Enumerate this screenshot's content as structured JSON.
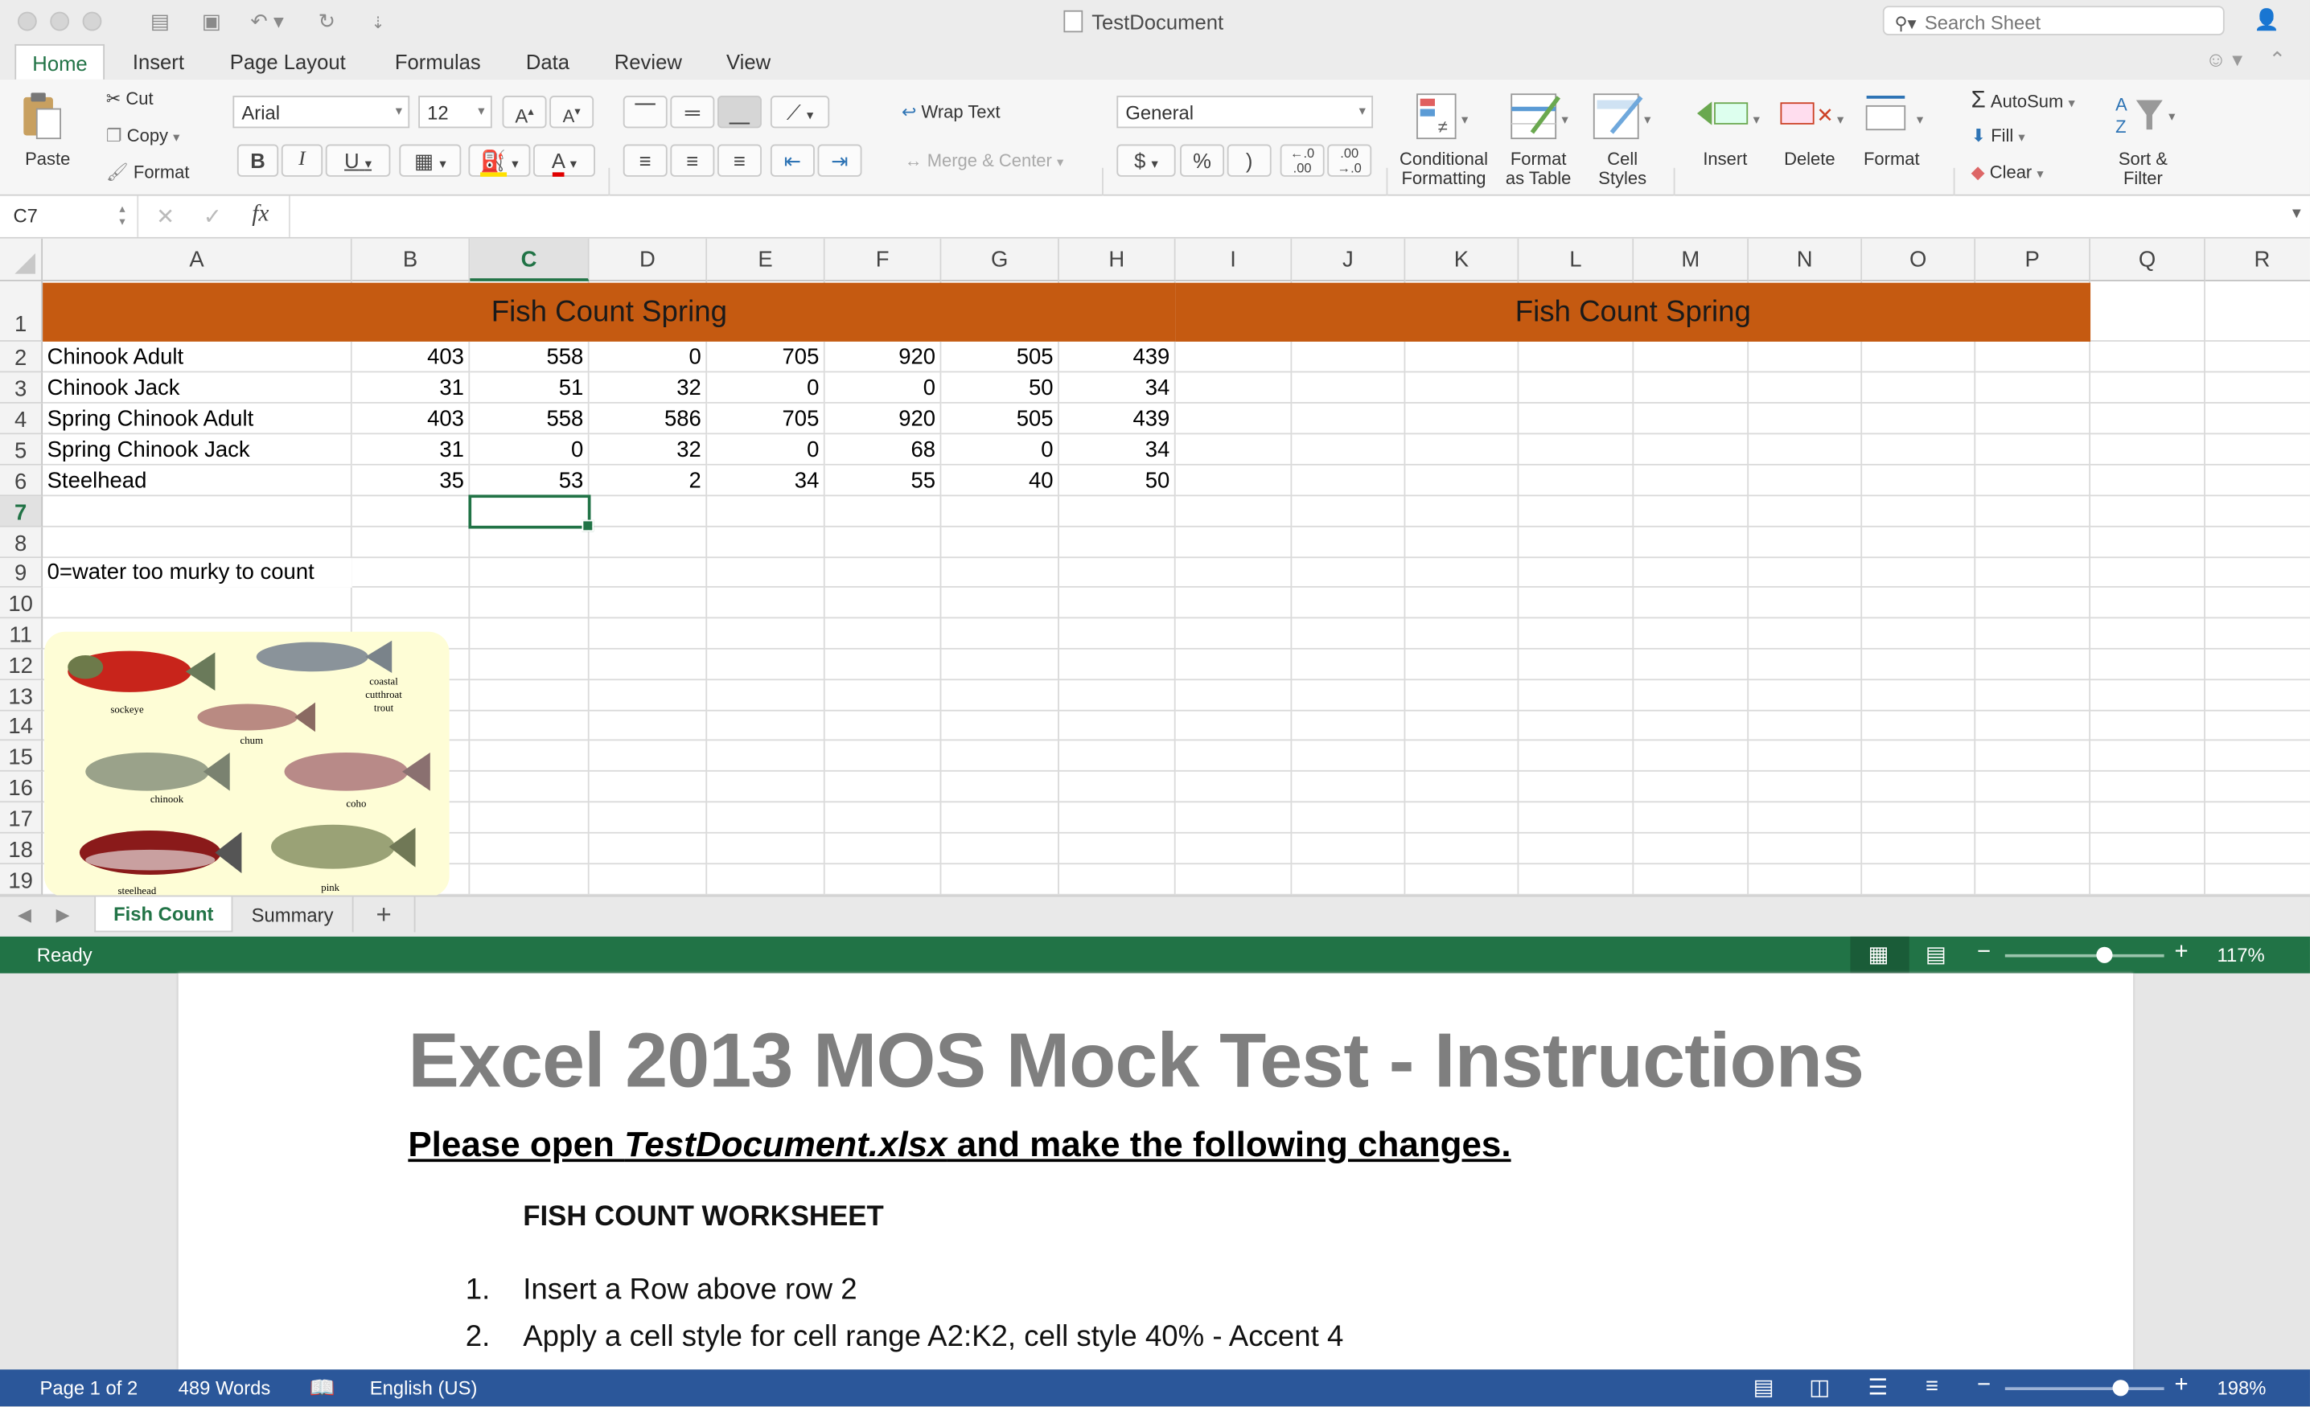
{
  "window": {
    "title": "TestDocument",
    "search_placeholder": "Search Sheet"
  },
  "ribbon_tabs": [
    "Home",
    "Insert",
    "Page Layout",
    "Formulas",
    "Data",
    "Review",
    "View"
  ],
  "ribbon": {
    "paste": "Paste",
    "cut": "Cut",
    "copy": "Copy",
    "format_painter": "Format",
    "font_name": "Arial",
    "font_size": "12",
    "bold": "B",
    "italic": "I",
    "underline": "U",
    "wrap_text": "Wrap Text",
    "merge_center": "Merge & Center",
    "number_format": "General",
    "currency": "$",
    "percent": "%",
    "comma": ")",
    "cond_format": [
      "Conditional",
      "Formatting"
    ],
    "format_table": [
      "Format",
      "as Table"
    ],
    "cell_styles": [
      "Cell",
      "Styles"
    ],
    "insert": "Insert",
    "delete": "Delete",
    "format": "Format",
    "autosum": "AutoSum",
    "fill": "Fill",
    "clear": "Clear",
    "sort_filter": [
      "Sort &",
      "Filter"
    ]
  },
  "formula_bar": {
    "name_box": "C7",
    "fx": "fx",
    "content": ""
  },
  "columns": [
    "A",
    "B",
    "C",
    "D",
    "E",
    "F",
    "G",
    "H",
    "I",
    "J",
    "K",
    "L",
    "M",
    "N",
    "O",
    "P",
    "Q",
    "R"
  ],
  "active_column": "C",
  "active_row": "7",
  "rows": [
    "1",
    "2",
    "3",
    "4",
    "5",
    "6",
    "7",
    "8",
    "9",
    "10",
    "11",
    "12",
    "13",
    "14",
    "15",
    "16",
    "17",
    "18",
    "19"
  ],
  "banners": [
    "Fish Count Spring",
    "Fish Count Spring"
  ],
  "table": [
    {
      "label": "Chinook Adult",
      "values": [
        "403",
        "558",
        "0",
        "705",
        "920",
        "505",
        "439"
      ]
    },
    {
      "label": "Chinook Jack",
      "values": [
        "31",
        "51",
        "32",
        "0",
        "0",
        "50",
        "34"
      ]
    },
    {
      "label": "Spring Chinook Adult",
      "values": [
        "403",
        "558",
        "586",
        "705",
        "920",
        "505",
        "439"
      ]
    },
    {
      "label": "Spring Chinook Jack",
      "values": [
        "31",
        "0",
        "32",
        "0",
        "68",
        "0",
        "34"
      ]
    },
    {
      "label": "Steelhead",
      "values": [
        "35",
        "53",
        "2",
        "34",
        "55",
        "40",
        "50"
      ]
    }
  ],
  "note": "0=water too murky to count",
  "fish_labels": [
    "sockeye",
    "coastal",
    "cutthroat",
    "trout",
    "chum",
    "chinook",
    "coho",
    "steelhead",
    "pink"
  ],
  "sheet_tabs": [
    "Fish Count",
    "Summary"
  ],
  "add_sheet": "+",
  "status": {
    "ready": "Ready",
    "zoom": "117%",
    "zoom_level": 0.62
  },
  "word": {
    "title": "Excel 2013 MOS Mock Test - Instructions",
    "subtitle_prefix": "Please open ",
    "subtitle_file": "TestDocument.xlsx",
    "subtitle_suffix": " and make the following changes.",
    "section": "FISH COUNT WORKSHEET",
    "items": [
      {
        "num": "1.",
        "text": "Insert a Row above row 2"
      },
      {
        "num": "2.",
        "text": "Apply a cell style for cell range A2:K2, cell style 40% - Accent 4"
      }
    ],
    "status": {
      "page": "Page 1 of 2",
      "words": "489 Words",
      "language": "English (US)",
      "zoom": "198%",
      "zoom_level": 0.72
    }
  },
  "colors": {
    "excel_green": "#217346",
    "banner": "#c55a11",
    "word_blue": "#2b579a",
    "title_gray": "#7f7f7f"
  }
}
